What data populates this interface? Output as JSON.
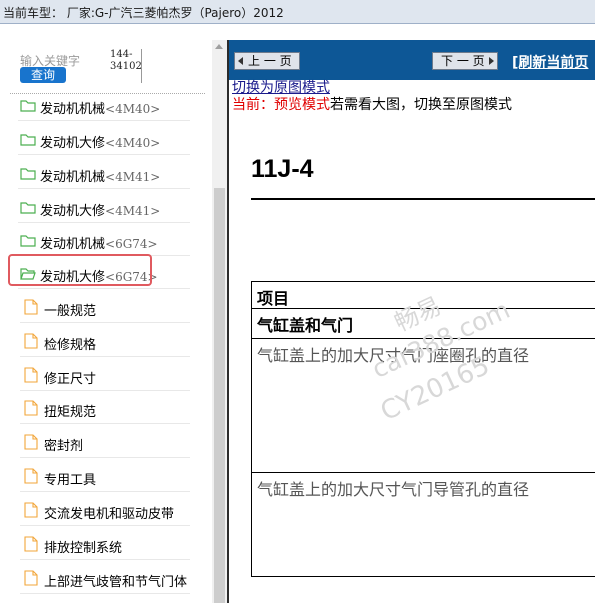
{
  "titlebar": {
    "text": "当前车型：   厂家:G-广汽三菱帕杰罗（Pajero）2012"
  },
  "left_panel": {
    "search_label": "输入关键字",
    "search_button": "查询",
    "code_lines": [
      "144-",
      "34102"
    ],
    "tree": [
      {
        "label": "发动机机械",
        "sub": "<4M40>"
      },
      {
        "label": "发动机大修",
        "sub": "<4M40>"
      },
      {
        "label": "发动机机械",
        "sub": "<4M41>"
      },
      {
        "label": "发动机大修",
        "sub": "<4M41>"
      },
      {
        "label": "发动机机械",
        "sub": "<6G74>"
      },
      {
        "label": "发动机大修",
        "sub": "<6G74>",
        "open": true
      }
    ],
    "docs": [
      "一般规范",
      "检修规格",
      "修正尺寸",
      "扭矩规范",
      "密封剂",
      "专用工具",
      "交流发电机和驱动皮带",
      "排放控制系统",
      "上部进气歧管和节气门体"
    ],
    "folder_color": "#4caf50",
    "doc_color": "#f2a63a",
    "selected_color": "#e05a5f"
  },
  "toolbar": {
    "prev_label": "上 一 页",
    "next_label": "下 一 页",
    "refresh_label": "[刷新当前页"
  },
  "content": {
    "switch_link": "切换为原图模式",
    "mode_prefix": "当前：预览模式",
    "mode_suffix": "若需看大图，切换至原图模式",
    "page_code": "11J-4",
    "table": {
      "header": "项目",
      "section": "气缸盖和气门",
      "row1": "气缸盖上的加大尺寸气门座圈孔的直径",
      "row2": "气缸盖上的加大尺寸气门导管孔的直径"
    },
    "watermark": [
      "畅易",
      "car388.com",
      "CY20165"
    ]
  }
}
